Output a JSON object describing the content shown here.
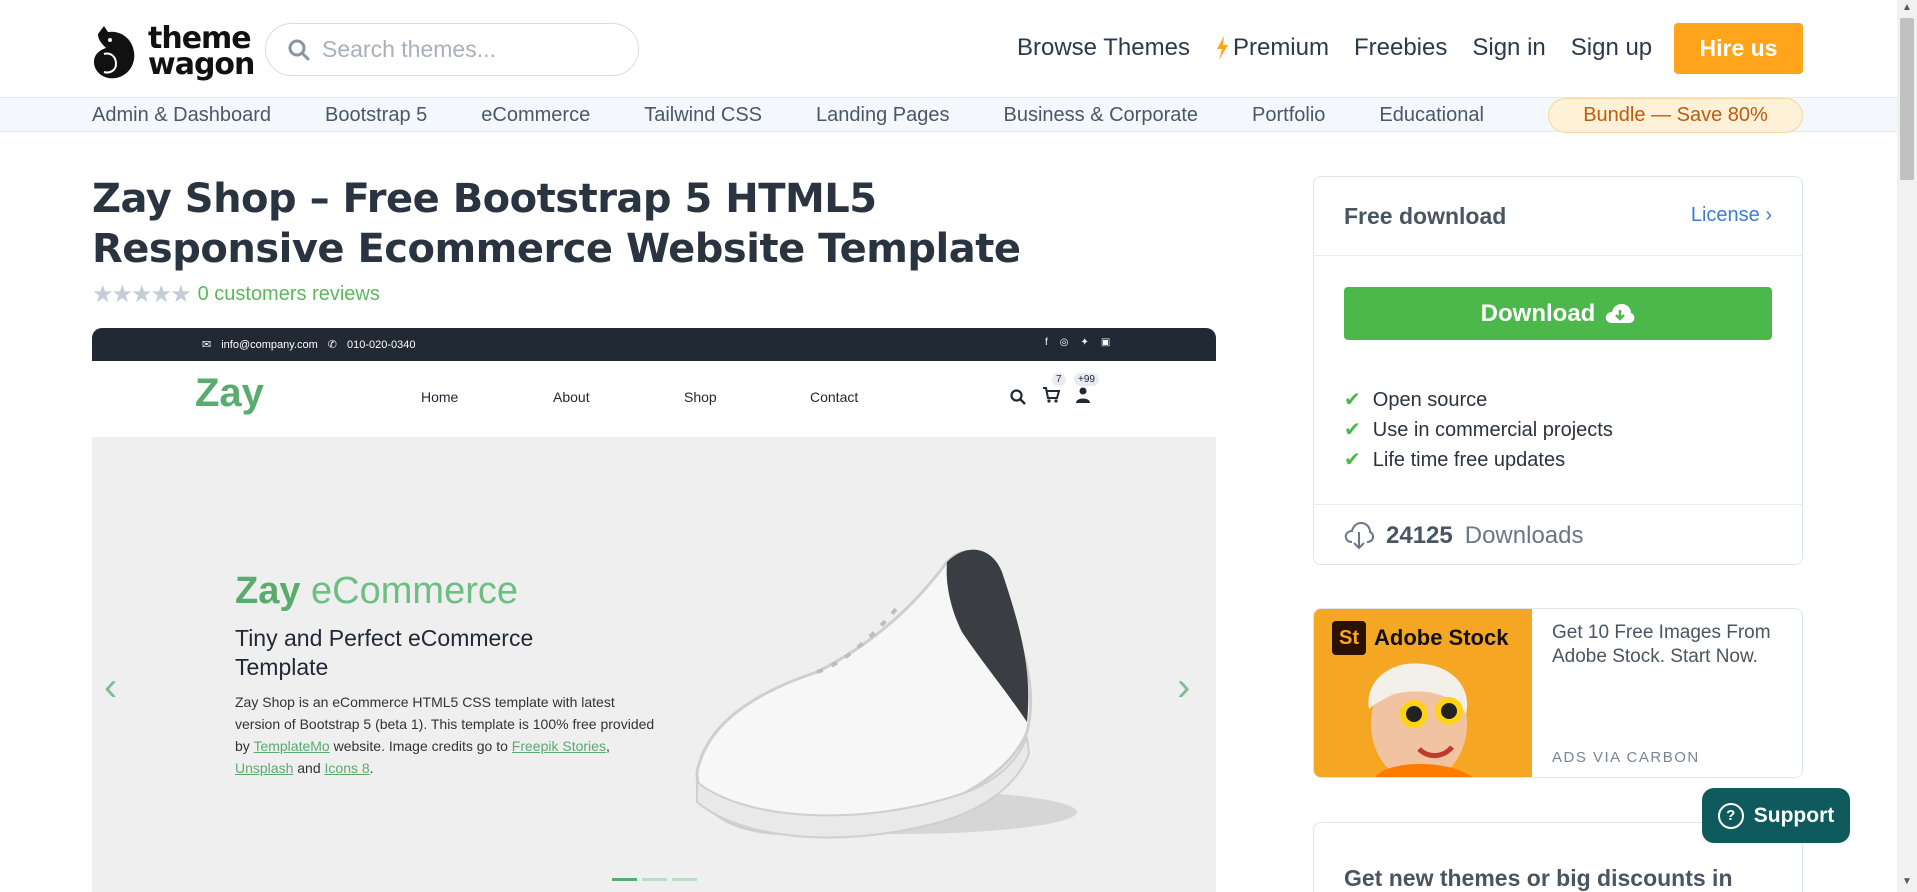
{
  "header": {
    "logo_text_line1": "theme",
    "logo_text_line2": "wagon",
    "search_placeholder": "Search themes...",
    "nav": [
      "Browse Themes",
      "Premium",
      "Freebies",
      "Sign in",
      "Sign up"
    ],
    "hire_label": "Hire us"
  },
  "categories": [
    "Admin & Dashboard",
    "Bootstrap 5",
    "eCommerce",
    "Tailwind CSS",
    "Landing Pages",
    "Business & Corporate",
    "Portfolio",
    "Educational"
  ],
  "bundle_label": "Bundle — Save 80%",
  "product": {
    "title": "Zay Shop – Free Bootstrap 5 HTML5 Responsive Ecommerce Website Template",
    "reviews_text": "0 customers reviews"
  },
  "preview": {
    "email": "info@company.com",
    "phone": "010-020-0340",
    "brand": "Zay",
    "links": [
      "Home",
      "About",
      "Shop",
      "Contact"
    ],
    "cart_badge": "7",
    "user_badge": "+99",
    "hero_title_bold": "Zay",
    "hero_title_light": "eCommerce",
    "hero_subtitle": "Tiny and Perfect eCommerce Template",
    "hero_text_1": "Zay Shop is an eCommerce HTML5 CSS template with latest version of Bootstrap 5 (beta 1). This template is 100% free provided by",
    "hero_link_1": "TemplateMo",
    "hero_text_2": "website. Image credits go to",
    "hero_link_2": "Freepik Stories",
    "hero_link_3": "Unsplash",
    "hero_text_3": "and",
    "hero_link_4": "Icons 8",
    "hero_text_4": "."
  },
  "download_card": {
    "title": "Free download",
    "license_label": "License",
    "download_label": "Download",
    "features": [
      "Open source",
      "Use in commercial projects",
      "Life time free updates"
    ],
    "downloads_count": "24125",
    "downloads_label": "Downloads"
  },
  "ad": {
    "brand": "Adobe Stock",
    "logo_text": "St",
    "text": "Get 10 Free Images From Adobe Stock. Start Now.",
    "via": "ADS VIA CARBON"
  },
  "newsletter": {
    "text": "Get new themes or big discounts in"
  },
  "support_label": "Support",
  "colors": {
    "accent_orange": "#ffa41b",
    "download_green": "#4cb74a",
    "zay_green": "#59ab6e",
    "support_teal": "#0f5a5c"
  }
}
